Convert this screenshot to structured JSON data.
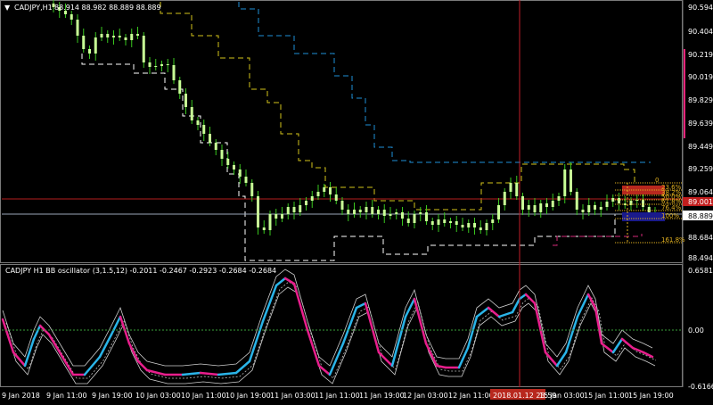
{
  "main_panel": {
    "menu_icon": "triangle-down-icon",
    "title": "CADJPY,H1",
    "ohlc": "88.914 88.982 88.889 88.889"
  },
  "osc_panel": {
    "title": "CADJPY H1  BB oscillator (3,1.5,12) -0.2011 -0.2467 -0.2923 -0.2684 -0.2684"
  },
  "price_axis": {
    "labels": [
      "90.594",
      "90.404",
      "90.219",
      "90.019",
      "89.829",
      "89.639",
      "89.449",
      "89.259",
      "89.064",
      "88.874",
      "88.684",
      "88.494"
    ],
    "current_price": "88.889",
    "marker_price": "89.001"
  },
  "osc_axis": {
    "labels": [
      "0.6581",
      "0.00",
      "-0.6166"
    ]
  },
  "time_axis": {
    "labels": [
      "9 Jan 2018",
      "9 Jan 11:00",
      "9 Jan 19:00",
      "10 Jan 03:00",
      "10 Jan 11:00",
      "10 Jan 19:00",
      "11 Jan 03:00",
      "11 Jan 11:00",
      "11 Jan 19:00",
      "12 Jan 03:00",
      "12 Jan 11:00",
      "15 Jan 03:00",
      "15 Jan 11:00",
      "15 Jan 19:00"
    ],
    "crosshair_time": "2018.01.12 23:59"
  },
  "fibonacci": {
    "levels": [
      "0",
      "23.6%",
      "38.2%",
      "50.0%",
      "61.8%",
      "76.4%",
      "100%",
      "161.8%"
    ]
  },
  "colors": {
    "background": "#000000",
    "bull_candle": "#c8ff96",
    "wick": "#39c61e",
    "envelope_upper": "#1e90d8",
    "envelope_mid": "#d4c41a",
    "envelope_lower": "#ffffff",
    "envelope_pink": "#d42a7a",
    "fib": "#e0b020",
    "osc_up": "#2ab4e8",
    "osc_down": "#e81e8c",
    "crosshair": "#c21e2a",
    "highlight_red": "#b8281e",
    "highlight_blue": "#1a1a8c"
  }
}
